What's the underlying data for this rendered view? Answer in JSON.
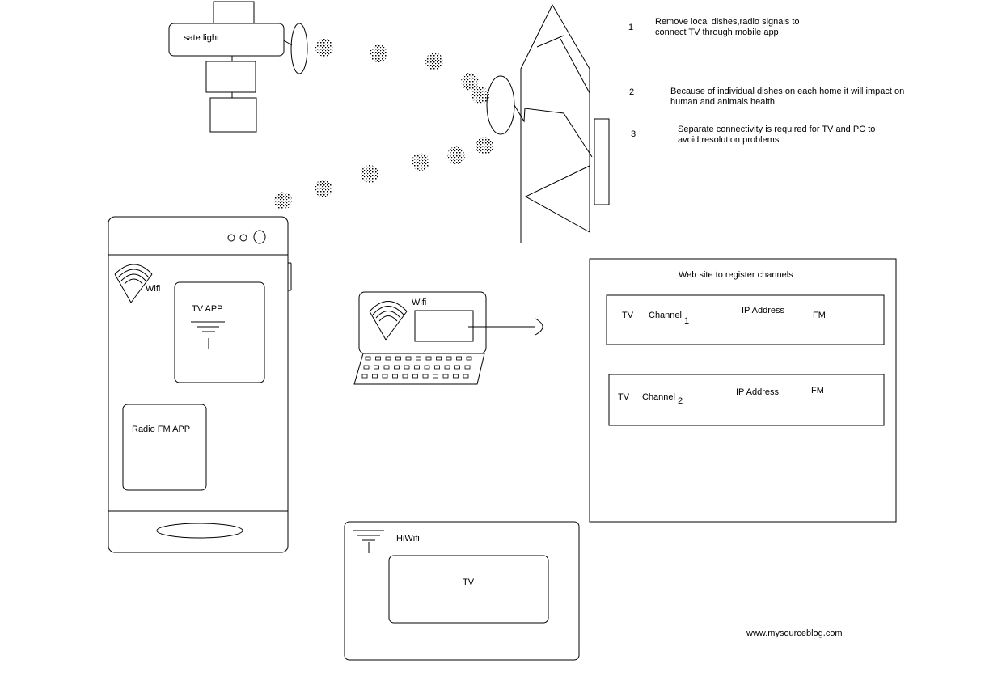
{
  "satellite": {
    "label": "sate light"
  },
  "notes": [
    {
      "num": "1",
      "text": "Remove local dishes,radio signals to connect TV through mobile app"
    },
    {
      "num": "2",
      "text": "Because of individual dishes on each home it will impact on human and animals health,"
    },
    {
      "num": "3",
      "text": "Separate connectivity is required for TV and PC to avoid resolution problems"
    }
  ],
  "phone": {
    "wifi_label": "Wifi",
    "tv_app_label": "TV APP",
    "radio_app_label": "Radio FM APP"
  },
  "laptop": {
    "wifi_label": "Wifi"
  },
  "website": {
    "title": "Web site to register channels",
    "rows": [
      {
        "tv": "TV",
        "channel": "Channel",
        "channel_num": "1",
        "ip": "IP Address",
        "fm": "FM"
      },
      {
        "tv": "TV",
        "channel": "Channel",
        "channel_num": "2",
        "ip": "IP Address",
        "fm": "FM"
      }
    ]
  },
  "tv_box": {
    "hiwifi_label": "HiWifi",
    "screen_label": "TV"
  },
  "footer": {
    "site": "www.mysourceblog.com"
  }
}
